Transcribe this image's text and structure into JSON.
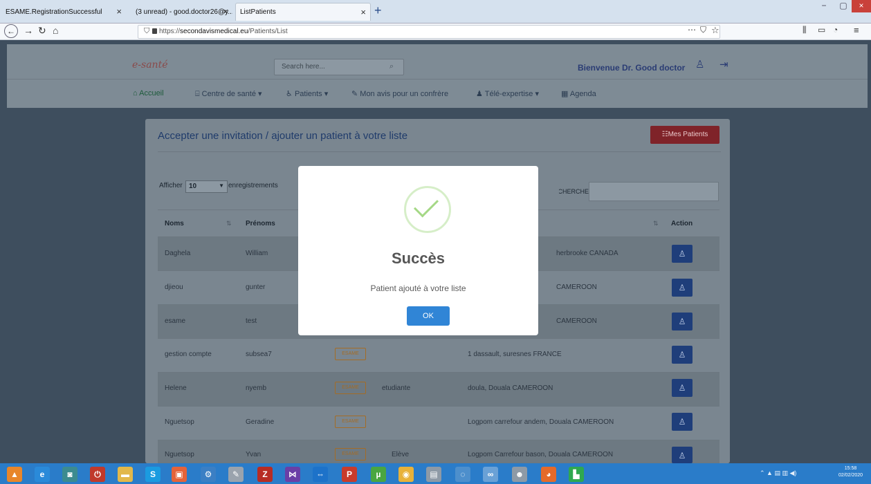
{
  "browser": {
    "tabs": [
      {
        "label": "ESAME.RegistrationSuccessful",
        "active": false
      },
      {
        "label": "(3 unread) - good.doctor26@y...",
        "active": false
      },
      {
        "label": "ListPatients",
        "active": true
      }
    ],
    "new_tab": "+",
    "url_prefix": "https://",
    "url_domain": "secondavismedical.eu",
    "url_path": "/Patients/List",
    "window_controls": [
      "−",
      "▢",
      "×"
    ],
    "nav_icons": [
      "back-icon",
      "forward-icon",
      "reload-icon",
      "home-icon"
    ],
    "toolbar_right": [
      "⋯",
      "⛉",
      "☆",
      "⫼",
      "▭",
      "◔",
      "≡"
    ]
  },
  "site": {
    "logo": "e-santé",
    "search_placeholder": "Search here...",
    "welcome": "Bienvenue Dr. Good doctor",
    "menu": [
      {
        "icon": "⌂",
        "label": "Accueil"
      },
      {
        "icon": "⌸",
        "label": "Centre de santé ▾"
      },
      {
        "icon": "♿",
        "label": "Patients ▾"
      },
      {
        "icon": "✎",
        "label": "Mon avis pour un confrère"
      },
      {
        "icon": "♟",
        "label": "Télé-expertise ▾"
      },
      {
        "icon": "▦",
        "label": "Agenda"
      }
    ]
  },
  "card": {
    "title": "Accepter une invitation / ajouter un patient à votre liste",
    "mes_patients_label": "☷Mes Patients",
    "afficher": "Afficher",
    "page_length": "10",
    "enregistrements": "enregistrements",
    "recherche": "RECHERCHE:"
  },
  "table": {
    "headers": {
      "noms": "Noms",
      "prenoms": "Prénoms",
      "action": "Action"
    },
    "rows": [
      {
        "nom": "Daghela",
        "prenom": "William",
        "badge": "",
        "profession": "",
        "adresse": "herbrooke CANADA"
      },
      {
        "nom": "djieou",
        "prenom": "gunter",
        "badge": "",
        "profession": "",
        "adresse": "CAMEROON"
      },
      {
        "nom": "esame",
        "prenom": "test",
        "badge": "",
        "profession": "",
        "adresse": "CAMEROON"
      },
      {
        "nom": "gestion compte",
        "prenom": "subsea7",
        "badge": "ESAME",
        "profession": "",
        "adresse": "1 dassault, suresnes FRANCE"
      },
      {
        "nom": "Helene",
        "prenom": "nyemb",
        "badge": "ESAME",
        "profession": "etudiante",
        "adresse": "doula, Douala CAMEROON"
      },
      {
        "nom": "Nguetsop",
        "prenom": "Geradine",
        "badge": "ESAME",
        "profession": "",
        "adresse": "Logpom carrefour andem, Douala CAMEROON"
      },
      {
        "nom": "Nguetsop",
        "prenom": "Yvan",
        "badge": "ESAME",
        "profession": "Elève",
        "adresse": "Logpom Carrefour bason, Douala CAMEROON"
      }
    ]
  },
  "modal": {
    "title": "Succès",
    "message": "Patient ajouté à votre liste",
    "ok_label": "OK"
  },
  "taskbar": {
    "icons": [
      {
        "name": "vlc-icon",
        "glyph": "▲",
        "color": "#e8862a"
      },
      {
        "name": "edge-icon",
        "glyph": "e",
        "color": "#2a8ad9"
      },
      {
        "name": "app-icon",
        "glyph": "◙",
        "color": "#3c8b8f"
      },
      {
        "name": "power-icon",
        "glyph": "⏻",
        "color": "#c0392b"
      },
      {
        "name": "folder-icon",
        "glyph": "▬",
        "color": "#e2b84a"
      },
      {
        "name": "skype-icon",
        "glyph": "S",
        "color": "#1b9be0"
      },
      {
        "name": "photo-icon",
        "glyph": "▣",
        "color": "#e5633a"
      },
      {
        "name": "network-icon",
        "glyph": "⚙",
        "color": "#3b7fc4"
      },
      {
        "name": "tool-icon",
        "glyph": "✎",
        "color": "#9aa3ad"
      },
      {
        "name": "filezilla-icon",
        "glyph": "Z",
        "color": "#b72c24"
      },
      {
        "name": "vs-icon",
        "glyph": "⋈",
        "color": "#6a3fa6"
      },
      {
        "name": "teamviewer-icon",
        "glyph": "⇔",
        "color": "#1d72c9"
      },
      {
        "name": "publisher-icon",
        "glyph": "P",
        "color": "#c93b2b"
      },
      {
        "name": "torrent-icon",
        "glyph": "µ",
        "color": "#4aa640"
      },
      {
        "name": "chrome-icon",
        "glyph": "◉",
        "color": "#e8b23a"
      },
      {
        "name": "document-icon",
        "glyph": "▤",
        "color": "#8e9aa6"
      },
      {
        "name": "wifi-icon",
        "glyph": "◌",
        "color": "#4d8fcc"
      },
      {
        "name": "network2-icon",
        "glyph": "∞",
        "color": "#6aa1d6"
      },
      {
        "name": "people-icon",
        "glyph": "☻",
        "color": "#8e9aa6"
      },
      {
        "name": "firefox-icon",
        "glyph": "◕",
        "color": "#e56a2a"
      },
      {
        "name": "green-app-icon",
        "glyph": "▙",
        "color": "#2fa84f"
      }
    ],
    "tray": "⌃ ▲ ▤ ▥ ◀)",
    "clock_time": "15:58",
    "clock_date": "02/02/2020"
  },
  "colors": {
    "overlay_bg": "#3e4e5e",
    "modal_ok": "#3085d6",
    "mes_patients": "#7f2329",
    "action_button": "#1f3e7a",
    "taskbar": "#2a7cc9"
  }
}
